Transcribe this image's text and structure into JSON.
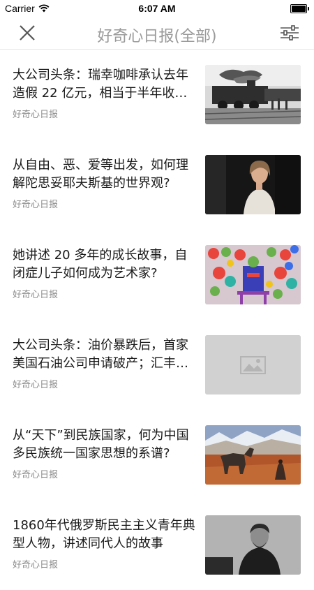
{
  "status_bar": {
    "carrier": "Carrier",
    "time": "6:07 AM"
  },
  "nav": {
    "title": "好奇心日报(全部)"
  },
  "articles": [
    {
      "title": "大公司头条：瑞幸咖啡承认去年造假 22 亿元，相当于半年收…",
      "source": "好奇心日报",
      "thumbnail": "photo-steam-train"
    },
    {
      "title": "从自由、恶、爱等出发，如何理解陀思妥耶夫斯基的世界观?",
      "source": "好奇心日报",
      "thumbnail": "photo-woman-portrait"
    },
    {
      "title": "她讲述 20 多年的成长故事，自闭症儿子如何成为艺术家?",
      "source": "好奇心日报",
      "thumbnail": "photo-colorful-painting"
    },
    {
      "title": "大公司头条：油价暴跌后，首家美国石油公司申请破产；汇丰…",
      "source": "好奇心日报",
      "thumbnail": "image-placeholder"
    },
    {
      "title": "从“天下”到民族国家，何为中国多民族统一国家思想的系谱?",
      "source": "好奇心日报",
      "thumbnail": "photo-donkey-landscape"
    },
    {
      "title": "1860年代俄罗斯民主主义青年典型人物，讲述同代人的故事",
      "source": "好奇心日报",
      "thumbnail": "photo-old-portrait"
    }
  ],
  "colors": {
    "title_text": "#1a1a1a",
    "source_text": "#8c8c8c",
    "nav_title": "#9a9a9a",
    "divider": "#e6e6e6"
  }
}
